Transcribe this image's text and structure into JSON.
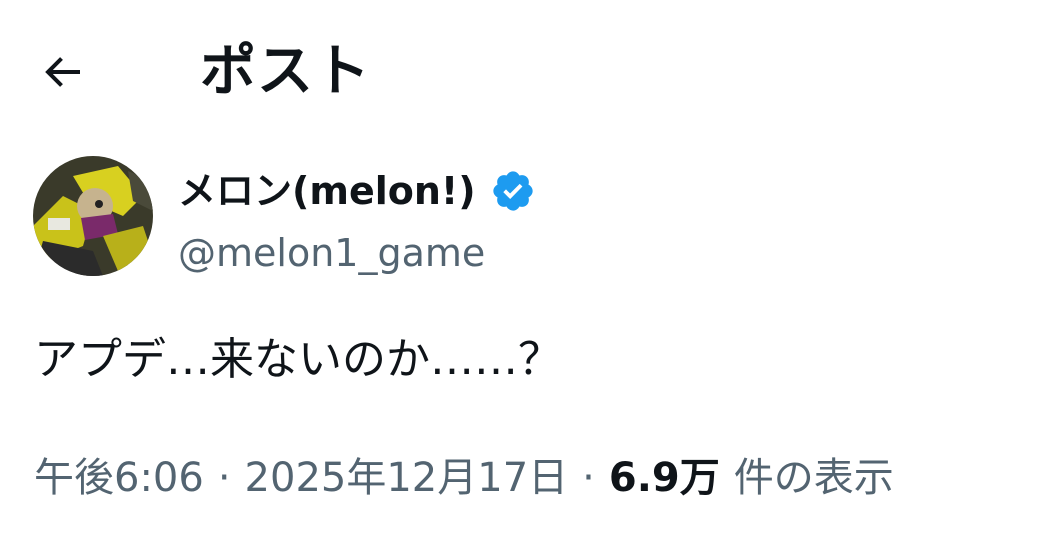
{
  "header": {
    "back_icon": "arrow-left-icon",
    "title": "ポスト"
  },
  "author": {
    "display_name": "メロン(melon!)",
    "verified_icon": "verified-badge-icon",
    "verified_color": "#1d9bf0",
    "handle": "@melon1_game"
  },
  "post": {
    "text": "アプデ…来ないのか……？"
  },
  "meta": {
    "time": "午後6:06",
    "separator": "·",
    "date": "2025年12月17日",
    "views_count": "6.9万",
    "views_label": "件の表示"
  },
  "colors": {
    "text_primary": "#0f1419",
    "text_secondary": "#536471",
    "accent": "#1d9bf0"
  }
}
